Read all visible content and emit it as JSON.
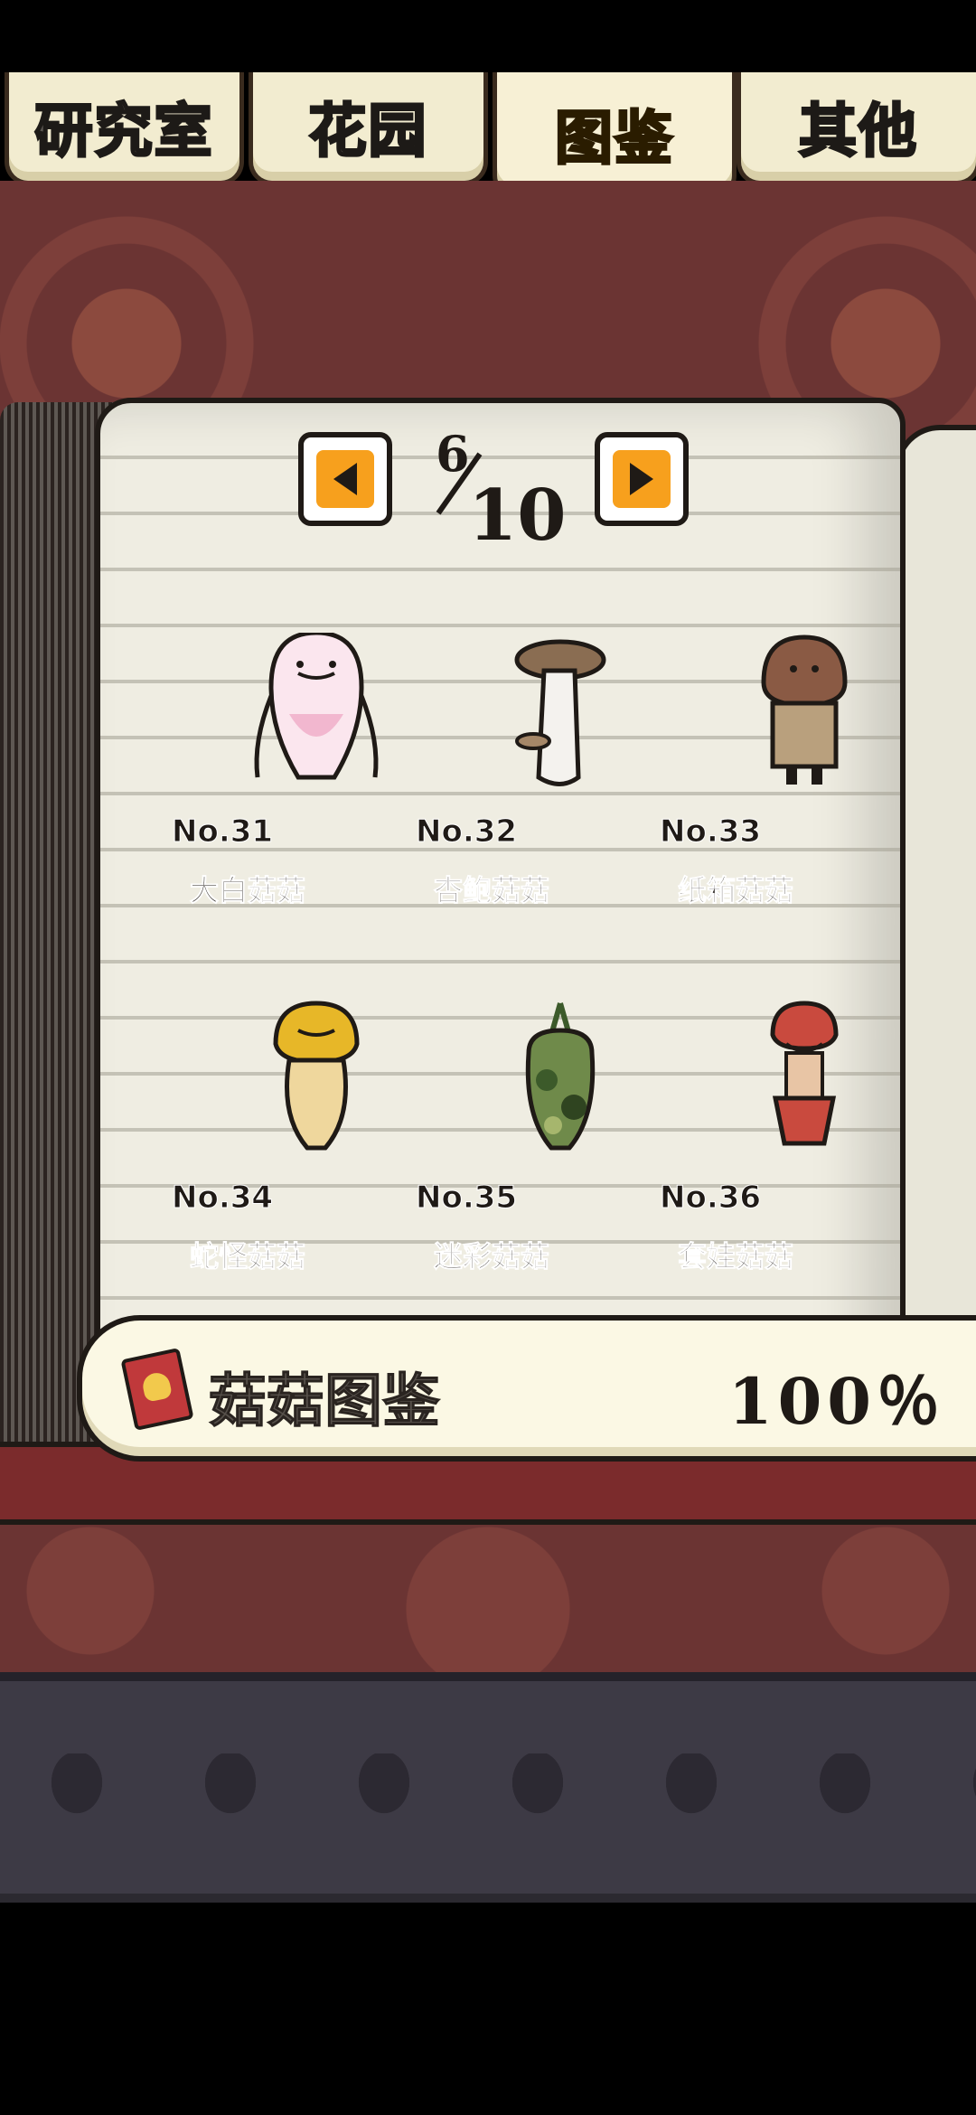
{
  "tabs": [
    {
      "label": "研究室",
      "active": false
    },
    {
      "label": "花园",
      "active": false
    },
    {
      "label": "图鉴",
      "active": true
    },
    {
      "label": "其他",
      "active": false
    }
  ],
  "pager": {
    "current": "6",
    "total": "10"
  },
  "mushrooms": [
    {
      "number": "No.31",
      "name": "大白菇菇",
      "icon": "white-mushroom-icon"
    },
    {
      "number": "No.32",
      "name": "杏鲍菇菇",
      "icon": "king-oyster-mushroom-icon"
    },
    {
      "number": "No.33",
      "name": "纸箱菇菇",
      "icon": "cardboard-mushroom-icon"
    },
    {
      "number": "No.34",
      "name": "蛇怪菇菇",
      "icon": "snake-mushroom-icon"
    },
    {
      "number": "No.35",
      "name": "迷彩菇菇",
      "icon": "camouflage-mushroom-icon"
    },
    {
      "number": "No.36",
      "name": "套娃菇菇",
      "icon": "matryoshka-mushroom-icon"
    }
  ],
  "collection": {
    "label": "菇菇图鉴",
    "percent": "100％",
    "percent_value": 100
  },
  "colors": {
    "accent": "#f7a01d",
    "active_tab_text": "#ffe44a",
    "background": "#6b3433"
  }
}
